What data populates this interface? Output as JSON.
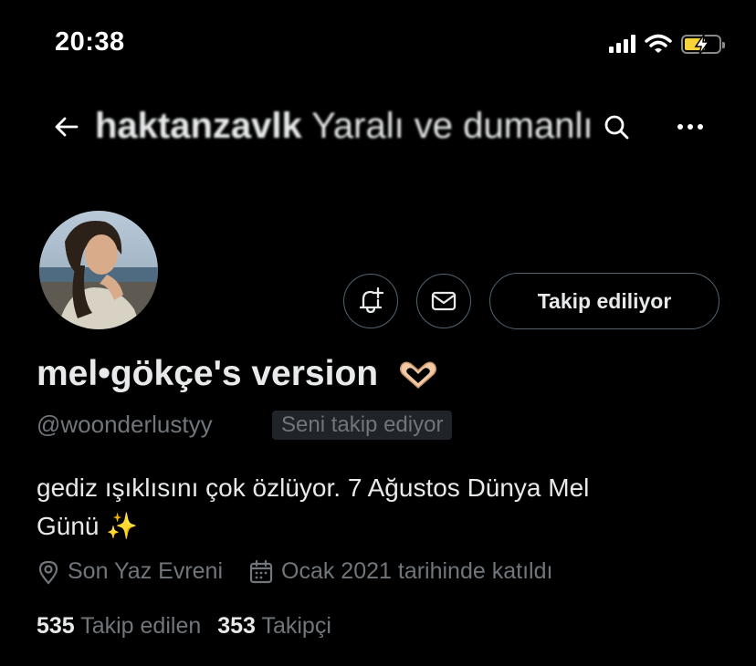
{
  "status_bar": {
    "time": "20:38"
  },
  "header": {
    "title_bold": "haktanzavlk",
    "title_rest": " Yaralı ve dumanlı"
  },
  "profile": {
    "display_name": "mel•gökçe's version",
    "name_emoji": "heart-hands",
    "handle": "@woonderlustyy",
    "follows_you_badge": "Seni takip ediyor",
    "bio_line1": "gediz ışıklısını çok özlüyor. 7 Ağustos Dünya Mel",
    "bio_line2": "Günü ✨",
    "location": "Son Yaz Evreni",
    "joined": "Ocak 2021 tarihinde katıldı",
    "following_count": "535",
    "following_label": "Takip edilen",
    "followers_count": "353",
    "followers_label": "Takipçi"
  },
  "actions": {
    "follow_button": "Takip ediliyor"
  },
  "colors": {
    "background": "#000000",
    "primary_text": "#e7e9ea",
    "secondary_text": "#71767b",
    "border": "#536471",
    "battery": "#f7d33a"
  }
}
